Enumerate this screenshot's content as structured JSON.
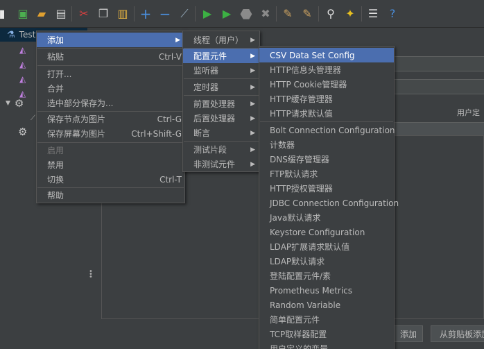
{
  "tree": {
    "root_label": "Test",
    "items": [
      "",
      "",
      "",
      ""
    ]
  },
  "content": {
    "user_defined_label": "用户定",
    "add_button": "添加",
    "clipboard_button": "从剪贴板添加"
  },
  "context_menu": {
    "add": "添加",
    "paste": "粘贴",
    "paste_shortcut": "Ctrl-V",
    "open": "打开...",
    "merge": "合并",
    "save_selection": "选中部分保存为...",
    "save_node_image": "保存节点为图片",
    "save_node_image_shortcut": "Ctrl-G",
    "save_screen_image": "保存屏幕为图片",
    "save_screen_image_shortcut": "Ctrl+Shift-G",
    "enable": "启用",
    "disable": "禁用",
    "toggle": "切换",
    "toggle_shortcut": "Ctrl-T",
    "help": "帮助"
  },
  "add_submenu": {
    "threads": "线程（用户）",
    "config_element": "配置元件",
    "listener": "监听器",
    "timer": "定时器",
    "pre_processor": "前置处理器",
    "post_processor": "后置处理器",
    "assertion": "断言",
    "test_fragment": "测试片段",
    "non_test_elements": "非测试元件"
  },
  "config_submenu": {
    "group1": [
      "CSV Data Set Config",
      "HTTP信息头管理器",
      "HTTP Cookie管理器",
      "HTTP缓存管理器",
      "HTTP请求默认值"
    ],
    "group2": [
      "Bolt Connection Configuration",
      "计数器",
      "DNS缓存管理器",
      "FTP默认请求",
      "HTTP授权管理器",
      "JDBC Connection Configuration",
      "Java默认请求",
      "Keystore Configuration",
      "LDAP扩展请求默认值",
      "LDAP默认请求",
      "登陆配置元件/素",
      "Prometheus Metrics",
      "Random Variable",
      "简单配置元件",
      "TCP取样器配置",
      "用户定义的变量"
    ]
  },
  "colors": {
    "highlight": "#4b6eaf",
    "background": "#3c3f41",
    "text": "#bbbbbb"
  }
}
